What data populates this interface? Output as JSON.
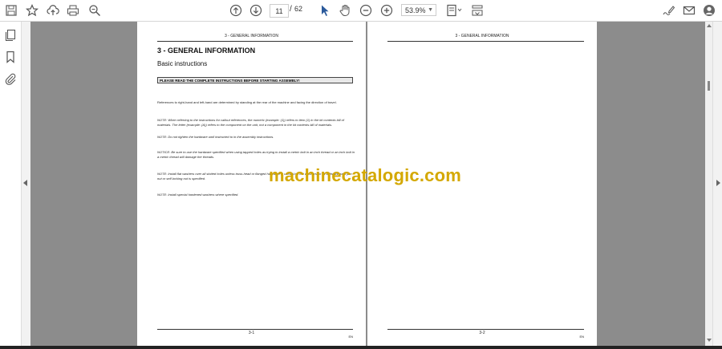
{
  "toolbar": {
    "current_page": "11",
    "separator": "/",
    "total_pages": "62",
    "zoom": "53.9%"
  },
  "page1": {
    "header": "3 - GENERAL INFORMATION",
    "title": "3 - GENERAL INFORMATION",
    "subtitle": "Basic instructions",
    "warning": "PLEASE READ THE COMPLETE INSTRUCTIONS BEFORE STARTING ASSEMBLY!",
    "paragraphs": [
      "References to right-hand and left-hand are determined by standing at the rear of the machine and facing the direction of travel.",
      "NOTE: When referring to the instructions for callout references, the numeric (example: (1)) refers to item (1) in the kit contents bill of materials. The letter (example: (A)) refers to the component on the unit, not a component in the kit contents bill of materials.",
      "NOTE: Do not tighten the hardware until instructed to in the assembly instructions.",
      "NOTICE: Be sure to use the hardware specified when using tapped holes as trying to install a metric bolt in an inch thread or an inch bolt in a metric thread will damage the threads.",
      "NOTE: Install flat washers over all slotted holes unless truss-head or flanged hardware is used. Use flat washers on all bolts unless a jam nut or self-locking nut is specified.",
      "NOTE: Install special hardened washers where specified."
    ],
    "page_number": "3-1",
    "lang": "EN"
  },
  "page2": {
    "header": "3 - GENERAL INFORMATION",
    "page_number": "3-2",
    "lang": "EN"
  },
  "watermark": "machinecatalogic.com"
}
